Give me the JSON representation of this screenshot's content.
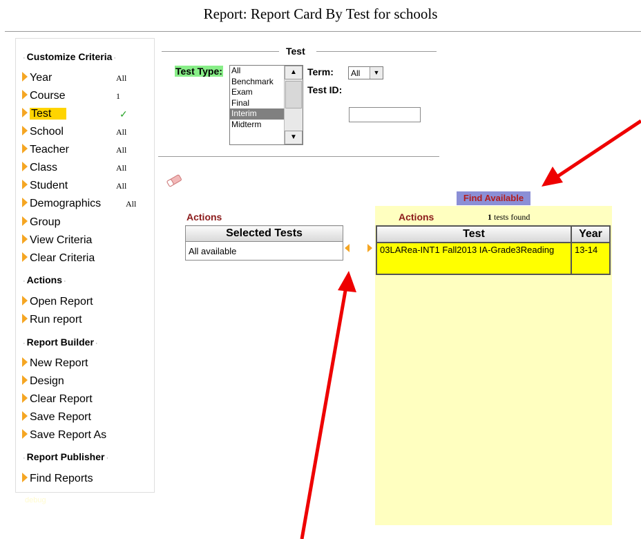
{
  "page": {
    "title": "Report: Report Card By Test for schools"
  },
  "sidebar": {
    "sections": [
      {
        "title": "Customize Criteria"
      },
      {
        "title": "Actions"
      },
      {
        "title": "Report Builder"
      },
      {
        "title": "Report Publisher"
      }
    ],
    "criteria": [
      {
        "label": "Year",
        "value": "All"
      },
      {
        "label": "Course",
        "value": "1"
      },
      {
        "label": "Test",
        "value": "✓"
      },
      {
        "label": "School",
        "value": "All"
      },
      {
        "label": "Teacher",
        "value": "All"
      },
      {
        "label": "Class",
        "value": "All"
      },
      {
        "label": "Student",
        "value": "All"
      },
      {
        "label": "Demographics",
        "value": "All"
      },
      {
        "label": "Group"
      },
      {
        "label": "View Criteria"
      },
      {
        "label": "Clear Criteria"
      }
    ],
    "actions": [
      {
        "label": "Open Report"
      },
      {
        "label": "Run report"
      }
    ],
    "builder": [
      {
        "label": "New Report"
      },
      {
        "label": "Design"
      },
      {
        "label": "Clear Report"
      },
      {
        "label": "Save Report"
      },
      {
        "label": "Save Report As"
      }
    ],
    "publisher": [
      {
        "label": "Find Reports"
      }
    ],
    "debug": "debug"
  },
  "test_panel": {
    "legend": "Test",
    "test_type_label": "Test Type:",
    "test_type_options": [
      "All",
      "Benchmark",
      "Exam",
      "Final",
      "Interim",
      "Midterm"
    ],
    "test_type_selected": "Interim",
    "term_label": "Term:",
    "term_value": "All",
    "test_id_label": "Test ID:",
    "test_id_value": ""
  },
  "find_available_label": "Find Available",
  "selected": {
    "actions_title": "Actions",
    "header": "Selected Tests",
    "rows": [
      "All available"
    ]
  },
  "available": {
    "actions_title": "Actions",
    "found_count": "1",
    "found_text": "tests found",
    "headers": [
      "Test",
      "Year"
    ],
    "rows": [
      {
        "test": "03LARea-INT1 Fall2013 IA-Grade3Reading",
        "year": "13-14"
      }
    ]
  },
  "colors": {
    "accent_arrow": "#f5a623",
    "active_item": "#ffd400",
    "panel_bg": "#ffffc0",
    "row_highlight": "#ffff00",
    "annotation": "#ee0000"
  }
}
